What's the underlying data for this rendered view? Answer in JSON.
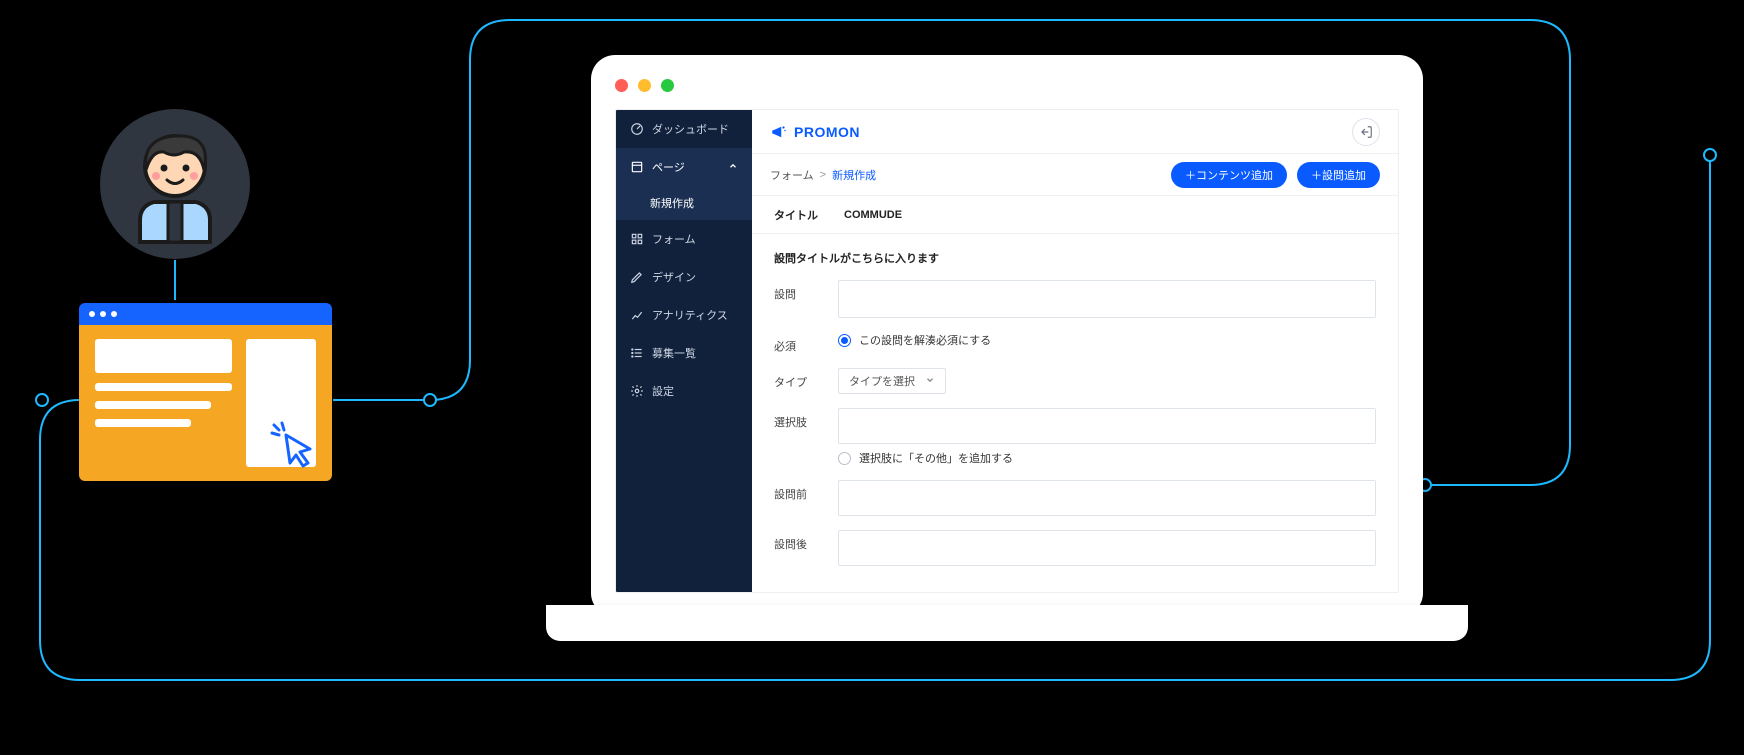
{
  "brand": {
    "name": "PROMON"
  },
  "sidebar": {
    "items": [
      {
        "label": "ダッシュボード"
      },
      {
        "label": "ページ"
      },
      {
        "label": "フォーム"
      },
      {
        "label": "デザイン"
      },
      {
        "label": "アナリティクス"
      },
      {
        "label": "募集一覧"
      },
      {
        "label": "設定"
      }
    ],
    "sub_new": "新規作成"
  },
  "breadcrumb": {
    "root": "フォーム",
    "sep": ">",
    "current": "新規作成"
  },
  "buttons": {
    "add_content": "＋コンテンツ追加",
    "add_question": "＋設問追加"
  },
  "titlebar": {
    "title_label": "タイトル",
    "title_value": "COMMUDE"
  },
  "section": {
    "heading": "設問タイトルがこちらに入ります"
  },
  "fields": {
    "question": "設問",
    "required": "必須",
    "required_text": "この設問を解湊必須にする",
    "type": "タイプ",
    "type_select": "タイプを選択",
    "choices": "選択肢",
    "choices_other": "選択肢に「その他」を追加する",
    "before": "設問前",
    "after": "設問後"
  }
}
